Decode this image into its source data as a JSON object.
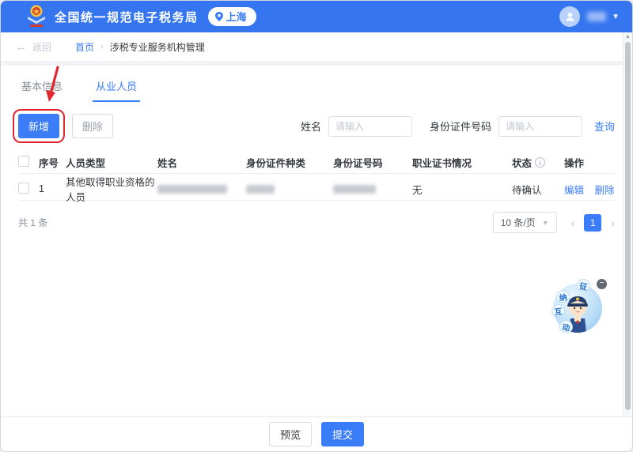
{
  "header": {
    "title": "全国统一规范电子税务局",
    "location_badge": "上海"
  },
  "breadcrumb": {
    "back_label": "返回",
    "home": "首页",
    "separator": "›",
    "current": "涉税专业服务机构管理"
  },
  "tabs": [
    {
      "label": "基本信息",
      "active": false
    },
    {
      "label": "从业人员",
      "active": true
    }
  ],
  "toolbar": {
    "add_label": "新增",
    "delete_label": "删除"
  },
  "search": {
    "name_label": "姓名",
    "name_placeholder": "请输入",
    "id_label": "身份证件号码",
    "id_placeholder": "请输入",
    "query_label": "查询"
  },
  "table": {
    "columns": [
      "序号",
      "人员类型",
      "姓名",
      "身份证件种类",
      "身份证号码",
      "职业证书情况",
      "状态",
      "操作"
    ],
    "rows": [
      {
        "index": "1",
        "person_type": "其他取得职业资格的人员",
        "name_redacted": true,
        "id_type_redacted": true,
        "id_number_redacted": true,
        "certificate": "无",
        "status": "待确认",
        "action_edit": "编辑",
        "action_delete": "删除"
      }
    ]
  },
  "pagination": {
    "total_label": "共 1 条",
    "page_size": "10 条/页",
    "prev": "‹",
    "current_page": "1",
    "next": "›"
  },
  "footer": {
    "preview_label": "预览",
    "submit_label": "提交"
  },
  "mascot": {
    "bubbles": [
      "征",
      "纳",
      "互",
      "动"
    ],
    "minimize": "−"
  },
  "colors": {
    "header_bg": "#3576f0",
    "accent": "#3b7cf8",
    "annotation_red": "#e0262e"
  }
}
